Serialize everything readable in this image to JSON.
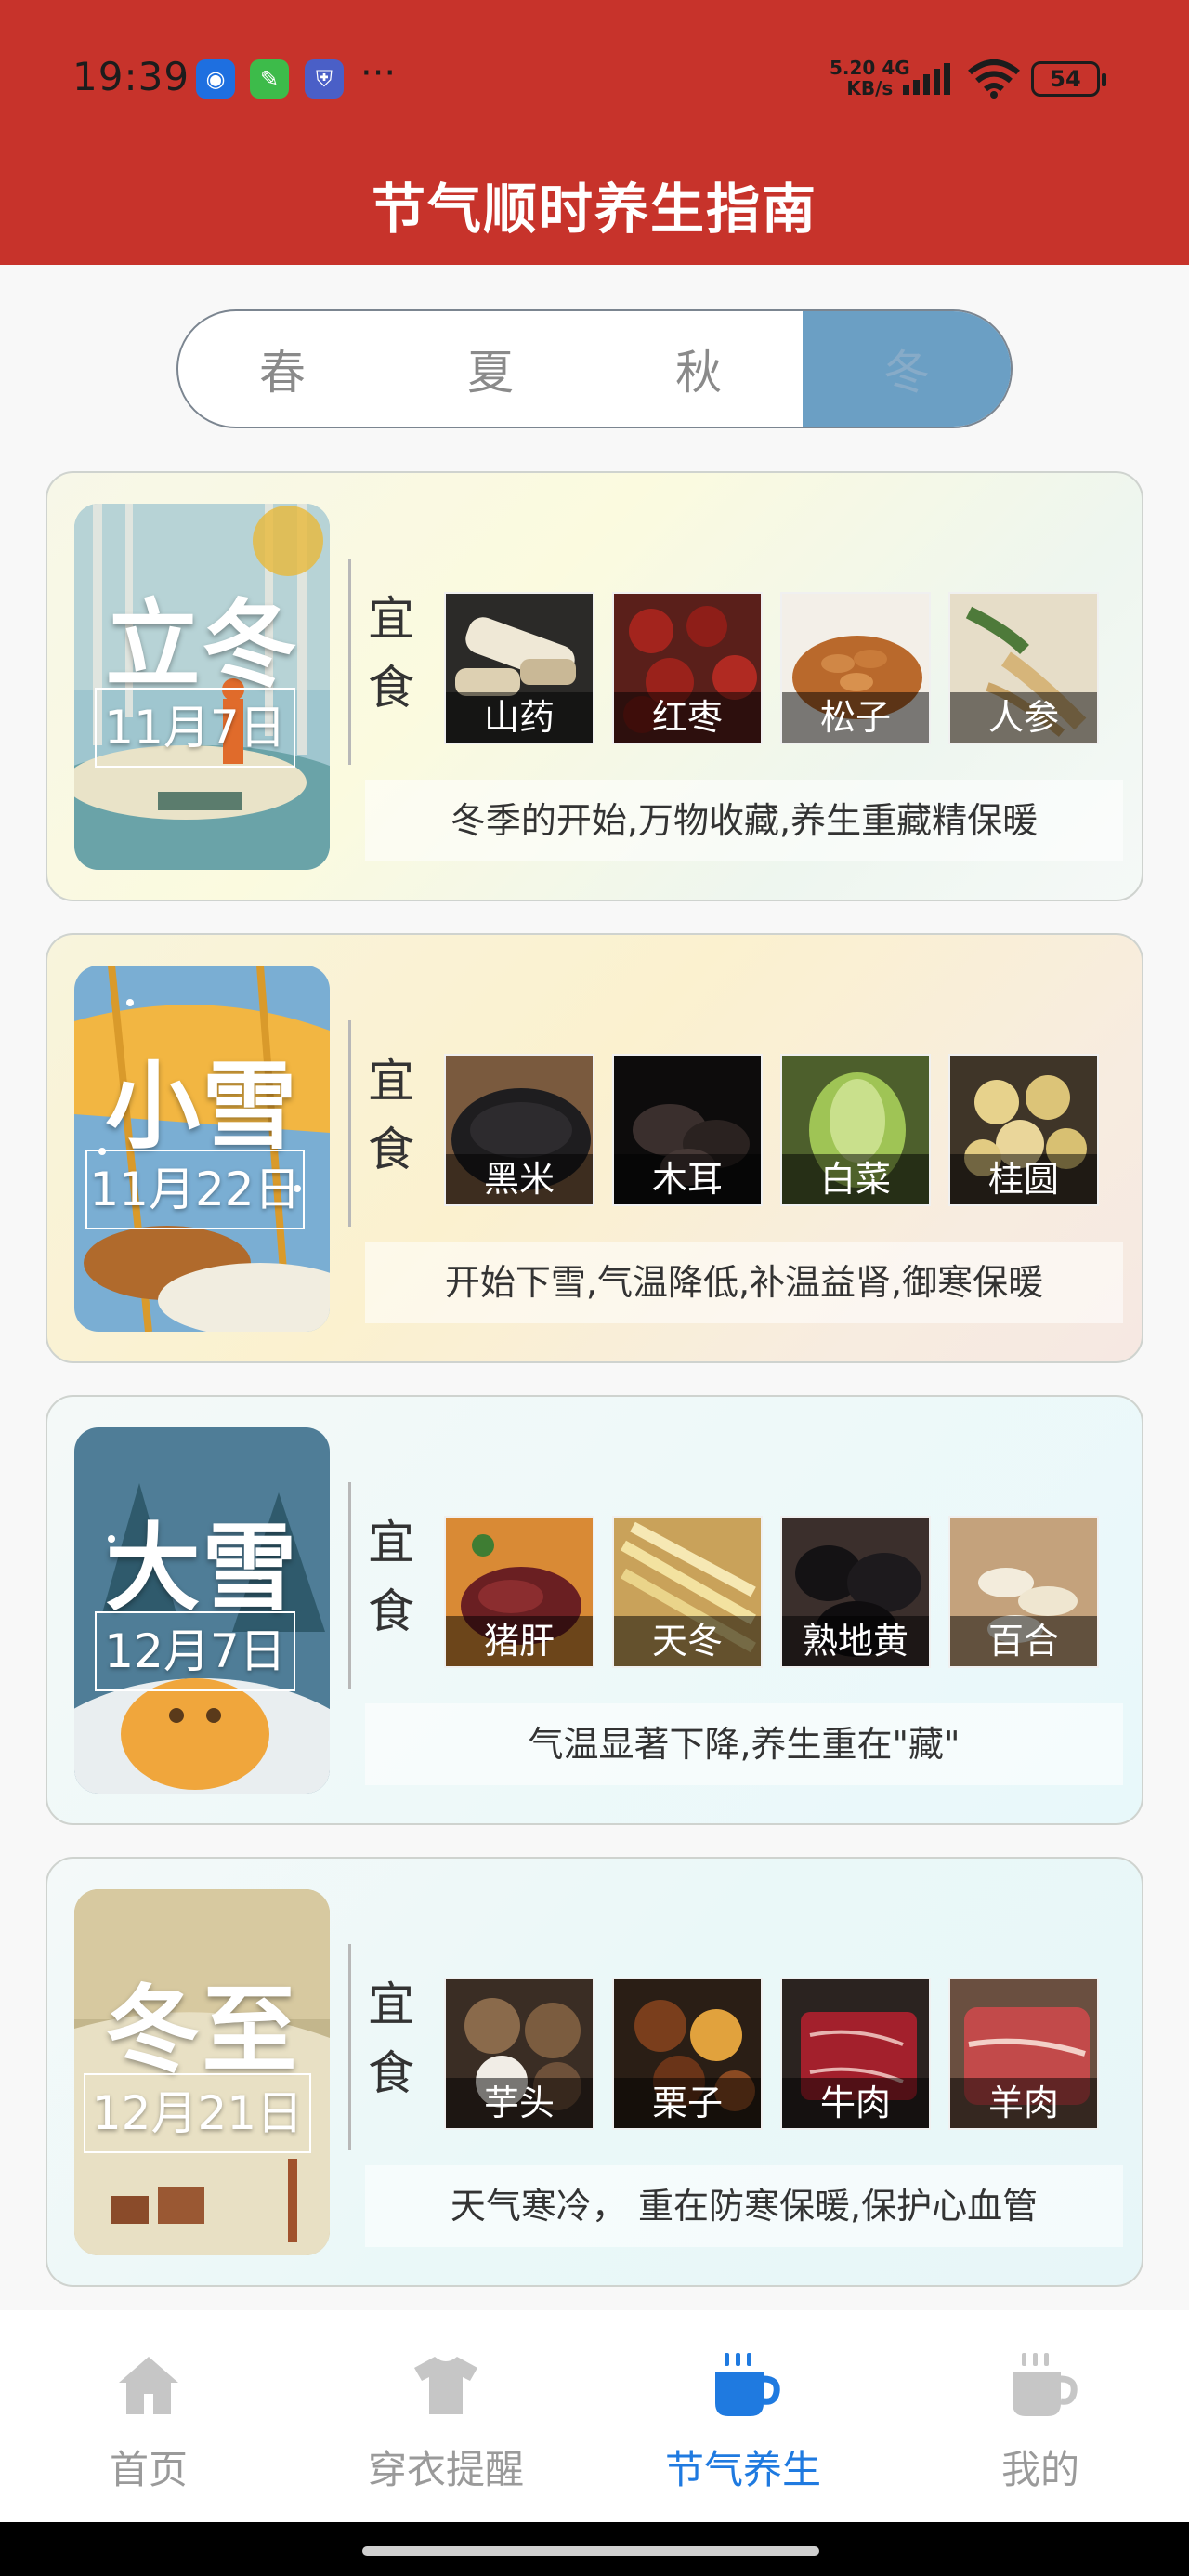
{
  "status_bar": {
    "time": "19:39",
    "speed_value": "5.20",
    "speed_unit": "KB/s",
    "network": "4G",
    "battery": "54"
  },
  "header": {
    "title": "节气顺时养生指南"
  },
  "tabs": [
    {
      "label": "春",
      "active": false
    },
    {
      "label": "夏",
      "active": false
    },
    {
      "label": "秋",
      "active": false
    },
    {
      "label": "冬",
      "active": true
    }
  ],
  "yishi_label": [
    "宜",
    "食"
  ],
  "terms": [
    {
      "name": "立冬",
      "date": "11月7日",
      "foods": [
        "山药",
        "红枣",
        "松子",
        "人参"
      ],
      "description": "冬季的开始,万物收藏,养生重藏精保暖"
    },
    {
      "name": "小雪",
      "date": "11月22日",
      "foods": [
        "黑米",
        "木耳",
        "白菜",
        "桂圆"
      ],
      "description": "开始下雪,气温降低,补温益肾,御寒保暖"
    },
    {
      "name": "大雪",
      "date": "12月7日",
      "foods": [
        "猪肝",
        "天冬",
        "熟地黄",
        "百合"
      ],
      "description": "气温显著下降,养生重在\"藏\""
    },
    {
      "name": "冬至",
      "date": "12月21日",
      "foods": [
        "芋头",
        "栗子",
        "牛肉",
        "羊肉"
      ],
      "description": "天气寒冷， 重在防寒保暖,保护心血管"
    }
  ],
  "bottom_nav": [
    {
      "label": "首页",
      "icon": "home-icon",
      "active": false
    },
    {
      "label": "穿衣提醒",
      "icon": "shirt-icon",
      "active": false
    },
    {
      "label": "节气养生",
      "icon": "tea-cup-icon",
      "active": true
    },
    {
      "label": "我的",
      "icon": "mug-icon",
      "active": false
    }
  ],
  "colors": {
    "header": "#c7332b",
    "active_tab": "#6b9fc4",
    "active_nav": "#1f7ae0"
  }
}
